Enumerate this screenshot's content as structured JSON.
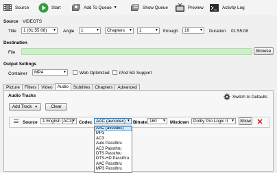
{
  "toolbar": {
    "source": "Source",
    "start": "Start",
    "add_to_queue": "Add To Queue",
    "show_queue": "Show Queue",
    "preview": "Preview",
    "activity_log": "Activity Log"
  },
  "source": {
    "heading": "Source",
    "name": "VIDEOTS",
    "title_label": "Title",
    "title_value": "1 (01:55:08)",
    "angle_label": "Angle",
    "angle_value": "1",
    "range_type": "Chapters",
    "range_start": "1",
    "through_label": "through",
    "range_end": "19",
    "duration_label": "Duration",
    "duration_value": "01:55:08"
  },
  "destination": {
    "heading": "Destination",
    "file_label": "File",
    "file_value": "",
    "browse": "Browse"
  },
  "output": {
    "heading": "Output Settings",
    "container_label": "Container",
    "container_value": "MP4",
    "web_optimized": "Web Optimized",
    "ipod_support": "iPod 5G Support"
  },
  "tabs": [
    "Picture",
    "Filters",
    "Video",
    "Audio",
    "Subtitles",
    "Chapters",
    "Advanced"
  ],
  "audio": {
    "heading": "Audio Tracks",
    "switch_defaults": "Switch to Defaults",
    "add_track": "Add Track",
    "clear": "Clear",
    "track": {
      "source_label": "Source",
      "source_value": "1 English (AC3)",
      "codec_label": "Codec",
      "codec_value": "AAC (avcodec)",
      "bitrate_label": "Bitrate",
      "bitrate_value": "160",
      "mixdown_label": "Mixdown",
      "mixdown_value": "Dolby Pro Logic II",
      "show": "Show"
    },
    "codec_options": [
      "AAC (avcodec)",
      "MP3",
      "AC3",
      "Auto Passthru",
      "AC3 Passthru",
      "DTS Passthru",
      "DTS-HD Passthru",
      "AAC Passthru",
      "MP3 Passthru"
    ],
    "codec_selected_index": 0
  },
  "colors": {
    "file_field_bg": "#cdf0c8",
    "start_green": "#2f9e3a",
    "selection_blue": "#cfe8fb",
    "remove_red": "#d42a2a"
  }
}
